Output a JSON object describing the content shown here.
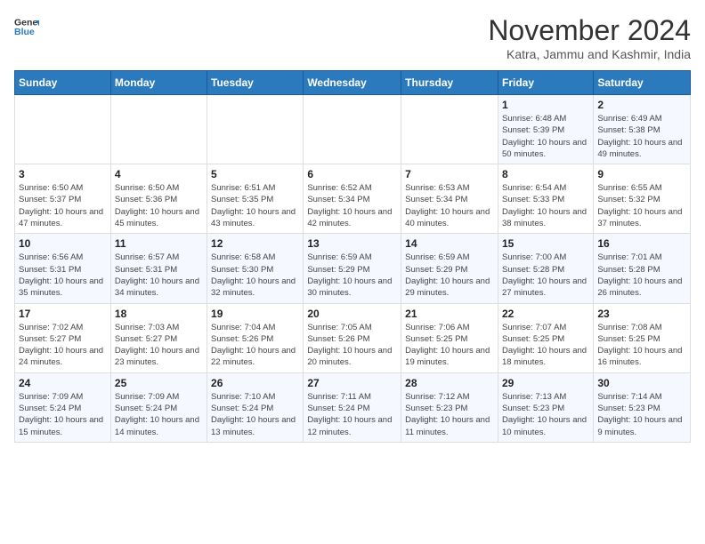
{
  "header": {
    "logo_line1": "General",
    "logo_line2": "Blue",
    "title": "November 2024",
    "subtitle": "Katra, Jammu and Kashmir, India"
  },
  "weekdays": [
    "Sunday",
    "Monday",
    "Tuesday",
    "Wednesday",
    "Thursday",
    "Friday",
    "Saturday"
  ],
  "weeks": [
    [
      {
        "day": "",
        "info": ""
      },
      {
        "day": "",
        "info": ""
      },
      {
        "day": "",
        "info": ""
      },
      {
        "day": "",
        "info": ""
      },
      {
        "day": "",
        "info": ""
      },
      {
        "day": "1",
        "info": "Sunrise: 6:48 AM\nSunset: 5:39 PM\nDaylight: 10 hours and 50 minutes."
      },
      {
        "day": "2",
        "info": "Sunrise: 6:49 AM\nSunset: 5:38 PM\nDaylight: 10 hours and 49 minutes."
      }
    ],
    [
      {
        "day": "3",
        "info": "Sunrise: 6:50 AM\nSunset: 5:37 PM\nDaylight: 10 hours and 47 minutes."
      },
      {
        "day": "4",
        "info": "Sunrise: 6:50 AM\nSunset: 5:36 PM\nDaylight: 10 hours and 45 minutes."
      },
      {
        "day": "5",
        "info": "Sunrise: 6:51 AM\nSunset: 5:35 PM\nDaylight: 10 hours and 43 minutes."
      },
      {
        "day": "6",
        "info": "Sunrise: 6:52 AM\nSunset: 5:34 PM\nDaylight: 10 hours and 42 minutes."
      },
      {
        "day": "7",
        "info": "Sunrise: 6:53 AM\nSunset: 5:34 PM\nDaylight: 10 hours and 40 minutes."
      },
      {
        "day": "8",
        "info": "Sunrise: 6:54 AM\nSunset: 5:33 PM\nDaylight: 10 hours and 38 minutes."
      },
      {
        "day": "9",
        "info": "Sunrise: 6:55 AM\nSunset: 5:32 PM\nDaylight: 10 hours and 37 minutes."
      }
    ],
    [
      {
        "day": "10",
        "info": "Sunrise: 6:56 AM\nSunset: 5:31 PM\nDaylight: 10 hours and 35 minutes."
      },
      {
        "day": "11",
        "info": "Sunrise: 6:57 AM\nSunset: 5:31 PM\nDaylight: 10 hours and 34 minutes."
      },
      {
        "day": "12",
        "info": "Sunrise: 6:58 AM\nSunset: 5:30 PM\nDaylight: 10 hours and 32 minutes."
      },
      {
        "day": "13",
        "info": "Sunrise: 6:59 AM\nSunset: 5:29 PM\nDaylight: 10 hours and 30 minutes."
      },
      {
        "day": "14",
        "info": "Sunrise: 6:59 AM\nSunset: 5:29 PM\nDaylight: 10 hours and 29 minutes."
      },
      {
        "day": "15",
        "info": "Sunrise: 7:00 AM\nSunset: 5:28 PM\nDaylight: 10 hours and 27 minutes."
      },
      {
        "day": "16",
        "info": "Sunrise: 7:01 AM\nSunset: 5:28 PM\nDaylight: 10 hours and 26 minutes."
      }
    ],
    [
      {
        "day": "17",
        "info": "Sunrise: 7:02 AM\nSunset: 5:27 PM\nDaylight: 10 hours and 24 minutes."
      },
      {
        "day": "18",
        "info": "Sunrise: 7:03 AM\nSunset: 5:27 PM\nDaylight: 10 hours and 23 minutes."
      },
      {
        "day": "19",
        "info": "Sunrise: 7:04 AM\nSunset: 5:26 PM\nDaylight: 10 hours and 22 minutes."
      },
      {
        "day": "20",
        "info": "Sunrise: 7:05 AM\nSunset: 5:26 PM\nDaylight: 10 hours and 20 minutes."
      },
      {
        "day": "21",
        "info": "Sunrise: 7:06 AM\nSunset: 5:25 PM\nDaylight: 10 hours and 19 minutes."
      },
      {
        "day": "22",
        "info": "Sunrise: 7:07 AM\nSunset: 5:25 PM\nDaylight: 10 hours and 18 minutes."
      },
      {
        "day": "23",
        "info": "Sunrise: 7:08 AM\nSunset: 5:25 PM\nDaylight: 10 hours and 16 minutes."
      }
    ],
    [
      {
        "day": "24",
        "info": "Sunrise: 7:09 AM\nSunset: 5:24 PM\nDaylight: 10 hours and 15 minutes."
      },
      {
        "day": "25",
        "info": "Sunrise: 7:09 AM\nSunset: 5:24 PM\nDaylight: 10 hours and 14 minutes."
      },
      {
        "day": "26",
        "info": "Sunrise: 7:10 AM\nSunset: 5:24 PM\nDaylight: 10 hours and 13 minutes."
      },
      {
        "day": "27",
        "info": "Sunrise: 7:11 AM\nSunset: 5:24 PM\nDaylight: 10 hours and 12 minutes."
      },
      {
        "day": "28",
        "info": "Sunrise: 7:12 AM\nSunset: 5:23 PM\nDaylight: 10 hours and 11 minutes."
      },
      {
        "day": "29",
        "info": "Sunrise: 7:13 AM\nSunset: 5:23 PM\nDaylight: 10 hours and 10 minutes."
      },
      {
        "day": "30",
        "info": "Sunrise: 7:14 AM\nSunset: 5:23 PM\nDaylight: 10 hours and 9 minutes."
      }
    ]
  ]
}
